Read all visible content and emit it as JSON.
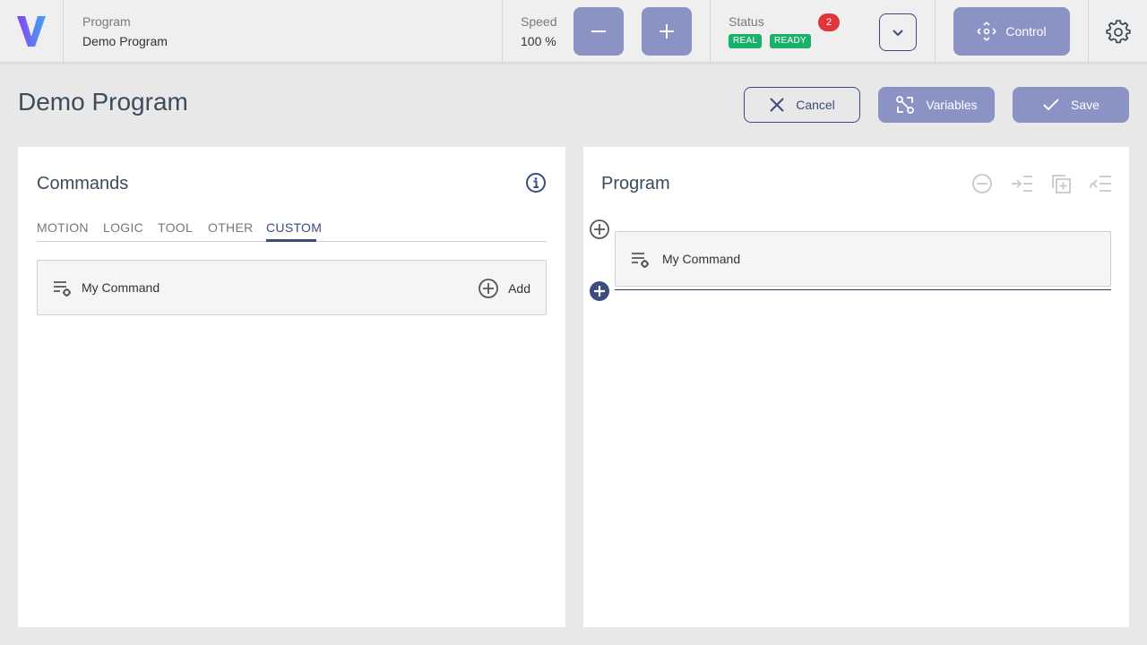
{
  "topbar": {
    "program_label": "Program",
    "program_value": "Demo Program",
    "speed_label": "Speed",
    "speed_value": "100 %",
    "status_label": "Status",
    "status_badges": [
      "REAL",
      "READY"
    ],
    "notification_count": "2",
    "control_label": "Control"
  },
  "header": {
    "title": "Demo Program",
    "cancel_label": "Cancel",
    "variables_label": "Variables",
    "save_label": "Save"
  },
  "commands_panel": {
    "title": "Commands",
    "tabs": [
      "MOTION",
      "LOGIC",
      "TOOL",
      "OTHER",
      "CUSTOM"
    ],
    "active_tab": "CUSTOM",
    "items": [
      {
        "label": "My Command",
        "action_label": "Add"
      }
    ]
  },
  "program_panel": {
    "title": "Program",
    "items": [
      {
        "label": "My Command"
      }
    ]
  },
  "colors": {
    "accent": "#3c4b80",
    "button_fill": "#8a93c4",
    "status_green": "#1ab26b",
    "notification_red": "#e0353b"
  }
}
